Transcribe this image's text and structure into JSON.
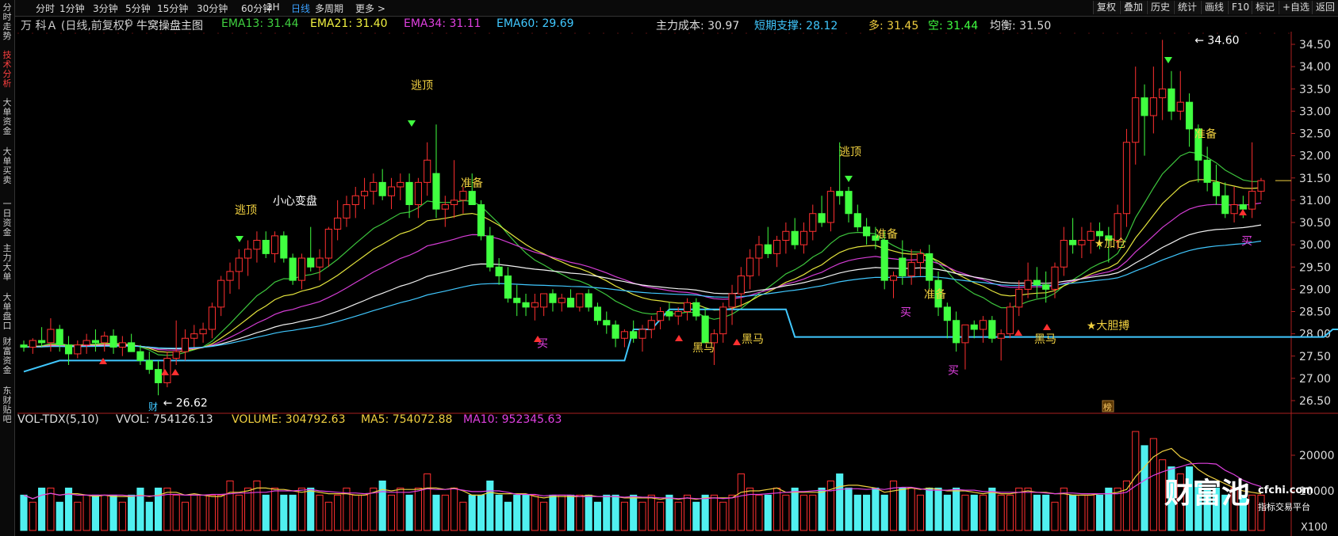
{
  "toolbar": {
    "timeframes": [
      "分时",
      "1分钟",
      "3分钟",
      "5分钟",
      "15分钟",
      "30分钟",
      "60分钟",
      "2H",
      "日线",
      "多周期",
      "更多 >"
    ],
    "active": "日线",
    "right_buttons": [
      "复权",
      "叠加",
      "历史",
      "统计",
      "画线",
      "F10",
      "标记",
      "+自选",
      "返回"
    ]
  },
  "sidebar": {
    "tabs": [
      "分时走势",
      "技术分析",
      "大单资金",
      "大单买卖",
      "一日资金",
      "主力大单",
      "大单盘口",
      "财富资金",
      "东财贴吧"
    ],
    "active": "技术分析"
  },
  "price_header": {
    "stock": "万 科Ａ (日线,前复权)",
    "indicator": "牛窝操盘主图",
    "ema13": "EMA13: 31.44",
    "ema21": "EMA21: 31.40",
    "ema34": "EMA34: 31.11",
    "ema60": "EMA60: 29.69",
    "cost": "主力成本: 30.97",
    "support": "短期支撑: 28.12",
    "bull": "多: 31.45",
    "bear": "空: 31.44",
    "balance": "均衡: 31.50"
  },
  "volume_header": {
    "name": "VOL-TDX(5,10)",
    "vvol": "VVOL: 754126.13",
    "volume": "VOLUME: 304792.63",
    "ma5": "MA5: 754072.88",
    "ma10": "MA10: 952345.63"
  },
  "watermark": {
    "logo": "财富池",
    "site": "cfchi.com",
    "tagline": "指标交易平台"
  },
  "colors": {
    "up": "#ff3030",
    "down": "#40ff40",
    "doji": "#ffff30",
    "vol_up": "#ff3030",
    "vol_down": "#50f0f0",
    "ema13": "#40d040",
    "ema21": "#f0f040",
    "ema34": "#e040e0",
    "ema60": "#ffffff",
    "cost": "#40c8ff",
    "support": "#40c8ff"
  },
  "chart_data": {
    "type": "candlestick",
    "y_axis": {
      "min": 26.5,
      "max": 34.5,
      "ticks": [
        26.5,
        27.0,
        27.5,
        28.0,
        28.5,
        29.0,
        29.5,
        30.0,
        30.5,
        31.0,
        31.5,
        32.0,
        32.5,
        33.0,
        33.5,
        34.0,
        34.5
      ]
    },
    "volume_axis": {
      "ticks": [
        10000,
        20000
      ],
      "unit": "X100"
    },
    "candles": [
      [
        27.75,
        27.85,
        27.6,
        27.7
      ],
      [
        27.7,
        27.9,
        27.55,
        27.85
      ],
      [
        27.85,
        28.15,
        27.7,
        27.8
      ],
      [
        27.8,
        28.35,
        27.6,
        28.1
      ],
      [
        28.1,
        28.2,
        27.6,
        27.75
      ],
      [
        27.75,
        27.95,
        27.3,
        27.55
      ],
      [
        27.55,
        27.85,
        27.45,
        27.75
      ],
      [
        27.75,
        28.0,
        27.55,
        27.85
      ],
      [
        27.85,
        28.1,
        27.6,
        27.8
      ],
      [
        27.8,
        28.05,
        27.6,
        27.95
      ],
      [
        27.95,
        28.1,
        27.55,
        27.7
      ],
      [
        27.7,
        27.95,
        27.5,
        27.8
      ],
      [
        27.8,
        28.0,
        27.6,
        27.6
      ],
      [
        27.6,
        27.75,
        27.3,
        27.4
      ],
      [
        27.4,
        27.6,
        27.1,
        27.2
      ],
      [
        27.2,
        27.4,
        26.62,
        26.9
      ],
      [
        26.9,
        27.6,
        26.8,
        27.45
      ],
      [
        27.45,
        28.3,
        27.3,
        27.6
      ],
      [
        27.6,
        28.1,
        27.4,
        27.9
      ],
      [
        27.9,
        28.2,
        27.7,
        28.0
      ],
      [
        28.0,
        28.25,
        27.8,
        28.1
      ],
      [
        28.1,
        28.7,
        27.9,
        28.6
      ],
      [
        28.6,
        29.3,
        28.4,
        29.2
      ],
      [
        29.2,
        29.6,
        28.9,
        29.4
      ],
      [
        29.4,
        29.9,
        29.0,
        29.7
      ],
      [
        29.7,
        30.1,
        29.3,
        29.9
      ],
      [
        29.9,
        30.3,
        29.6,
        30.1
      ],
      [
        30.1,
        30.3,
        29.7,
        29.8
      ],
      [
        29.8,
        30.3,
        29.6,
        30.2
      ],
      [
        30.2,
        30.3,
        29.6,
        29.7
      ],
      [
        29.7,
        29.8,
        29.1,
        29.2
      ],
      [
        29.2,
        29.8,
        29.0,
        29.7
      ],
      [
        29.7,
        30.4,
        29.4,
        29.5
      ],
      [
        29.5,
        29.9,
        29.2,
        29.7
      ],
      [
        29.7,
        30.4,
        29.5,
        30.35
      ],
      [
        30.35,
        31.0,
        30.1,
        30.6
      ],
      [
        30.6,
        31.1,
        30.4,
        30.9
      ],
      [
        30.9,
        31.3,
        30.6,
        31.1
      ],
      [
        31.1,
        31.5,
        30.8,
        31.2
      ],
      [
        31.2,
        31.6,
        30.9,
        31.4
      ],
      [
        31.4,
        31.7,
        31.0,
        31.1
      ],
      [
        31.1,
        31.5,
        30.8,
        31.3
      ],
      [
        31.3,
        31.6,
        31.0,
        31.4
      ],
      [
        31.4,
        31.6,
        30.6,
        30.9
      ],
      [
        30.9,
        31.5,
        30.6,
        31.4
      ],
      [
        31.4,
        32.3,
        31.1,
        31.9
      ],
      [
        31.6,
        32.7,
        30.6,
        30.8
      ],
      [
        30.8,
        31.1,
        30.4,
        30.9
      ],
      [
        30.9,
        31.9,
        30.6,
        31.0
      ],
      [
        31.0,
        31.3,
        30.7,
        31.2
      ],
      [
        31.2,
        31.6,
        30.9,
        30.9
      ],
      [
        30.9,
        31.0,
        30.1,
        30.2
      ],
      [
        30.2,
        30.4,
        29.4,
        29.5
      ],
      [
        29.5,
        29.7,
        29.1,
        29.3
      ],
      [
        29.3,
        29.5,
        28.7,
        28.8
      ],
      [
        28.8,
        29.1,
        28.4,
        28.7
      ],
      [
        28.7,
        28.9,
        28.4,
        28.6
      ],
      [
        28.6,
        28.9,
        28.3,
        28.7
      ],
      [
        28.6,
        28.8,
        28.4,
        28.9
      ],
      [
        28.9,
        29.0,
        28.5,
        28.7
      ],
      [
        28.7,
        28.9,
        28.5,
        28.8
      ],
      [
        28.8,
        29.0,
        28.6,
        28.6
      ],
      [
        28.6,
        28.9,
        28.5,
        28.9
      ],
      [
        28.9,
        29.0,
        28.5,
        28.6
      ],
      [
        28.6,
        28.7,
        28.2,
        28.3
      ],
      [
        28.3,
        28.5,
        28.0,
        28.2
      ],
      [
        28.2,
        28.3,
        27.7,
        27.9
      ],
      [
        27.9,
        28.1,
        27.7,
        28.05
      ],
      [
        28.05,
        28.3,
        27.8,
        27.9
      ],
      [
        27.9,
        28.2,
        27.6,
        28.1
      ],
      [
        28.1,
        28.4,
        27.9,
        28.3
      ],
      [
        28.3,
        28.6,
        28.1,
        28.5
      ],
      [
        28.5,
        28.7,
        28.3,
        28.4
      ],
      [
        28.4,
        28.6,
        28.2,
        28.5
      ],
      [
        28.5,
        28.8,
        28.3,
        28.7
      ],
      [
        28.7,
        28.8,
        28.3,
        28.4
      ],
      [
        28.4,
        28.6,
        27.8,
        27.8
      ],
      [
        27.8,
        28.1,
        27.3,
        28.0
      ],
      [
        28.0,
        28.7,
        27.8,
        28.6
      ],
      [
        28.6,
        29.1,
        28.2,
        28.9
      ],
      [
        28.9,
        29.5,
        28.6,
        29.3
      ],
      [
        29.3,
        29.9,
        29.0,
        29.7
      ],
      [
        29.7,
        30.2,
        29.3,
        30.0
      ],
      [
        30.0,
        30.4,
        29.7,
        29.8
      ],
      [
        29.8,
        30.2,
        29.5,
        30.1
      ],
      [
        30.1,
        30.5,
        29.8,
        30.3
      ],
      [
        30.3,
        30.6,
        29.9,
        30.0
      ],
      [
        30.0,
        30.5,
        29.8,
        30.3
      ],
      [
        30.3,
        30.9,
        30.1,
        30.7
      ],
      [
        30.7,
        31.1,
        30.4,
        30.5
      ],
      [
        30.5,
        31.3,
        30.3,
        31.2
      ],
      [
        31.2,
        32.3,
        30.9,
        31.1
      ],
      [
        31.2,
        31.3,
        30.5,
        30.7
      ],
      [
        30.7,
        30.9,
        30.3,
        30.4
      ],
      [
        30.4,
        30.6,
        30.0,
        30.2
      ],
      [
        30.2,
        30.4,
        29.9,
        30.1
      ],
      [
        30.1,
        30.3,
        29.0,
        29.2
      ],
      [
        29.2,
        29.4,
        28.8,
        29.3
      ],
      [
        29.7,
        30.1,
        29.1,
        29.3
      ],
      [
        29.3,
        29.9,
        29.1,
        29.6
      ],
      [
        29.6,
        29.9,
        29.3,
        29.8
      ],
      [
        29.8,
        30.0,
        29.0,
        29.2
      ],
      [
        29.2,
        29.4,
        28.4,
        28.6
      ],
      [
        28.6,
        28.7,
        27.9,
        28.3
      ],
      [
        28.3,
        28.5,
        27.6,
        27.8
      ],
      [
        27.8,
        28.2,
        27.2,
        28.2
      ],
      [
        28.2,
        28.3,
        27.9,
        28.1
      ],
      [
        28.1,
        28.4,
        27.8,
        28.3
      ],
      [
        28.3,
        28.4,
        27.8,
        27.9
      ],
      [
        27.9,
        28.1,
        27.4,
        28.0
      ],
      [
        28.0,
        28.7,
        27.9,
        28.6
      ],
      [
        28.6,
        29.2,
        28.4,
        29.0
      ],
      [
        29.0,
        29.6,
        28.8,
        29.2
      ],
      [
        29.2,
        29.5,
        28.8,
        29.1
      ],
      [
        29.1,
        29.4,
        28.7,
        29.0
      ],
      [
        29.0,
        29.6,
        28.8,
        29.5
      ],
      [
        29.5,
        30.4,
        29.3,
        30.1
      ],
      [
        30.1,
        30.6,
        29.8,
        30.0
      ],
      [
        30.0,
        30.4,
        29.7,
        30.1
      ],
      [
        30.1,
        30.5,
        29.8,
        30.3
      ],
      [
        30.3,
        30.5,
        29.9,
        30.2
      ],
      [
        30.2,
        30.4,
        29.6,
        30.1
      ],
      [
        30.1,
        30.9,
        29.9,
        30.7
      ],
      [
        30.7,
        32.6,
        30.4,
        32.3
      ],
      [
        32.3,
        34.0,
        31.8,
        33.3
      ],
      [
        33.3,
        33.6,
        32.0,
        32.9
      ],
      [
        32.9,
        34.0,
        32.5,
        33.3
      ],
      [
        33.3,
        34.6,
        32.8,
        33.5
      ],
      [
        33.5,
        33.9,
        32.8,
        33.0
      ],
      [
        33.0,
        33.9,
        32.8,
        33.2
      ],
      [
        33.2,
        33.4,
        32.2,
        32.6
      ],
      [
        32.6,
        32.7,
        31.4,
        31.9
      ],
      [
        31.9,
        32.2,
        31.2,
        31.4
      ],
      [
        31.4,
        31.8,
        30.9,
        31.1
      ],
      [
        31.1,
        31.4,
        30.6,
        30.7
      ],
      [
        30.7,
        31.3,
        30.5,
        30.9
      ],
      [
        30.9,
        31.1,
        30.6,
        30.8
      ],
      [
        30.8,
        32.3,
        30.6,
        31.2
      ],
      [
        31.2,
        31.5,
        31.0,
        31.44
      ]
    ],
    "price_line_labels": {
      "high": "34.60",
      "low": "26.62"
    },
    "annotations": [
      {
        "text": "逃顶",
        "color": "#f0d040"
      },
      {
        "text": "小心变盘",
        "color": "#ffffff"
      },
      {
        "text": "逃顶",
        "color": "#f0d040"
      },
      {
        "text": "准备",
        "color": "#f0d040"
      },
      {
        "text": "买",
        "color": "#e040e0"
      },
      {
        "text": "黑马",
        "color": "#f0d040"
      },
      {
        "text": "黑马",
        "color": "#f0d040"
      },
      {
        "text": "逃顶",
        "color": "#f0d040"
      },
      {
        "text": "准备",
        "color": "#f0d040"
      },
      {
        "text": "买",
        "color": "#e040e0"
      },
      {
        "text": "准备",
        "color": "#f0d040"
      },
      {
        "text": "买",
        "color": "#e040e0"
      },
      {
        "text": "黑马",
        "color": "#f0d040"
      },
      {
        "text": "★加仓",
        "color": "#f0d040"
      },
      {
        "text": "★大胆搏",
        "color": "#f0d040"
      },
      {
        "text": "准备",
        "color": "#f0d040"
      },
      {
        "text": "买",
        "color": "#e040e0"
      }
    ],
    "finance_label": "财",
    "event_label": "榜"
  }
}
